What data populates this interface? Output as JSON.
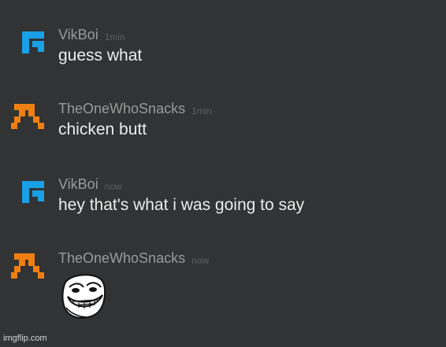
{
  "messages": [
    {
      "user": "VikBoi",
      "time": "1min",
      "text": "guess what",
      "avatar": "blue-pixel-avatar-icon"
    },
    {
      "user": "TheOneWhoSnacks",
      "time": "1min",
      "text": "chicken butt",
      "avatar": "orange-chevron-avatar-icon"
    },
    {
      "user": "VikBoi",
      "time": "now",
      "text": "hey that's what i was going to say",
      "avatar": "blue-pixel-avatar-icon"
    },
    {
      "user": "TheOneWhoSnacks",
      "time": "now",
      "text": "",
      "image": "trollface-emoji",
      "avatar": "orange-chevron-avatar-icon"
    }
  ],
  "watermark": "imgflip.com",
  "colors": {
    "background": "#323334",
    "username": "#9a9a9a",
    "timestamp": "#5d5f61",
    "message": "#ececec",
    "blue_avatar": "#19a0e6",
    "orange_avatar": "#ef7f12"
  }
}
